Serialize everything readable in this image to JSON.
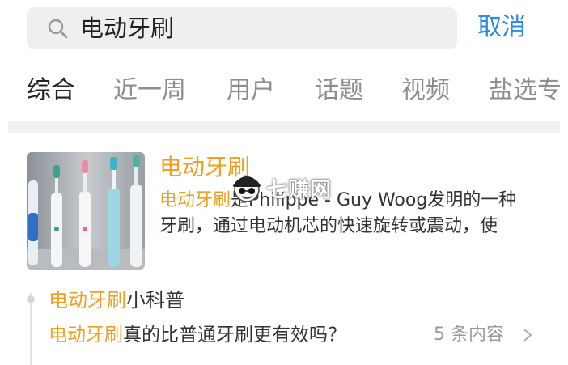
{
  "search": {
    "query": "电动牙刷",
    "cancel_label": "取消"
  },
  "tabs": [
    {
      "label": "综合",
      "active": true
    },
    {
      "label": "近一周",
      "active": false
    },
    {
      "label": "用户",
      "active": false
    },
    {
      "label": "话题",
      "active": false
    },
    {
      "label": "视频",
      "active": false
    },
    {
      "label": "盐选专",
      "active": false
    }
  ],
  "result": {
    "title": "电动牙刷",
    "line1_highlight": "电动牙刷",
    "line1_rest": "是Philippe - Guy Woog发明的一种",
    "line2": "牙刷，通过电动机芯的快速旋转或震动，使"
  },
  "watermark": {
    "text": "七赚网"
  },
  "subtopic": {
    "title_highlight": "电动牙刷",
    "title_rest": "小科普",
    "question_highlight": "电动牙刷",
    "question_rest": "真的比普通牙刷更有效吗？",
    "count_label": "5 条内容"
  },
  "colors": {
    "accent": "#2a8ae8",
    "highlight": "#f0a020",
    "tab_active": "#222222",
    "tab_inactive": "#8e8e8e"
  }
}
